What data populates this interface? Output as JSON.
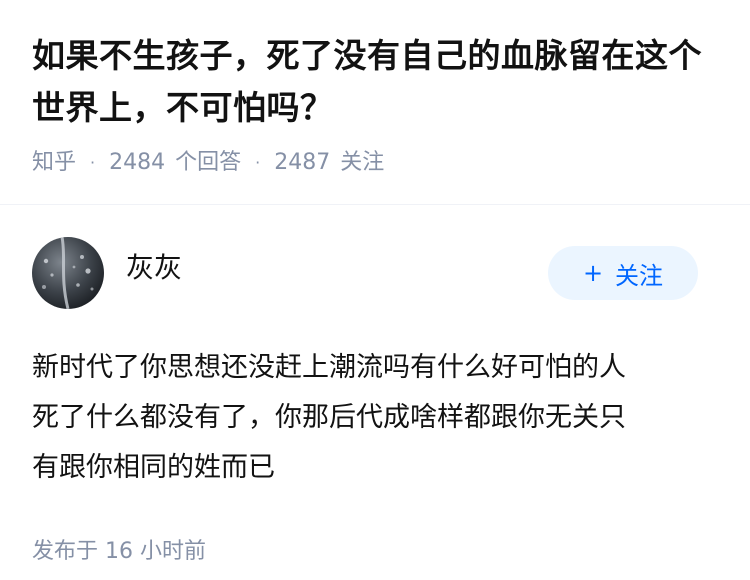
{
  "question": {
    "title": "如果不生孩子，死了没有自己的血脉留在这个世界上，不可怕吗？",
    "source": "知乎",
    "answer_count": "2484",
    "answer_label": "个回答",
    "follower_count": "2487",
    "follower_label": "关注"
  },
  "answer": {
    "author": {
      "name": "灰灰",
      "avatar_icon": "avatar-image"
    },
    "follow_button": {
      "icon": "+",
      "label": "关注"
    },
    "content": [
      "新时代了你思想还没赶上潮流吗有什么好可怕的人",
      "死了什么都没有了，你那后代成啥样都跟你无关只",
      "有跟你相同的姓而已"
    ],
    "published": "发布于  16 小时前"
  },
  "colors": {
    "title": "#121212",
    "meta": "#8590a6",
    "follow_bg": "#ebf5ff",
    "follow_text": "#0066ff"
  }
}
